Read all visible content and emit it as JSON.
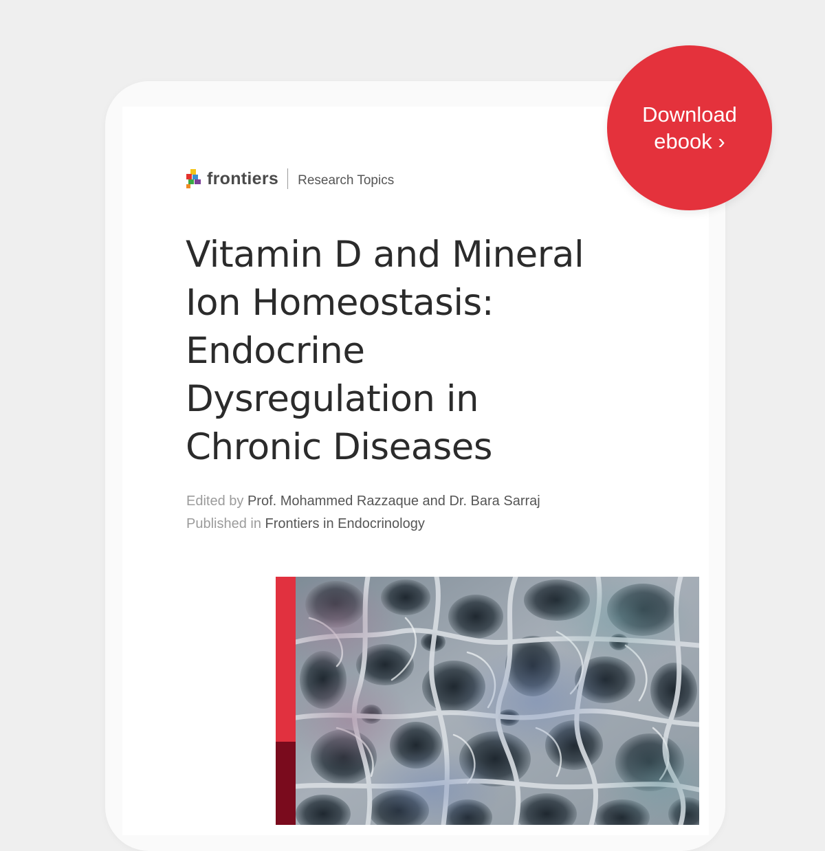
{
  "brand": {
    "logo_text": "frontiers",
    "section": "Research Topics"
  },
  "book": {
    "title_lines": [
      "Vitamin D and Mineral",
      "Ion Homeostasis:",
      "Endocrine",
      "Dysregulation in",
      "Chronic Diseases"
    ],
    "edited_prefix": "Edited by",
    "editors": "Prof. Mohammed Razzaque and Dr. Bara Sarraj",
    "published_prefix": "Published in",
    "journal": "Frontiers in Endocrinology"
  },
  "cta": {
    "line1": "Download",
    "line2": "ebook ›"
  },
  "colors": {
    "background": "#efefef",
    "accent_red": "#e1313f",
    "accent_dark_red": "#7a0b1d",
    "badge_red": "#e4323c",
    "title_text": "#2b2b2b"
  }
}
